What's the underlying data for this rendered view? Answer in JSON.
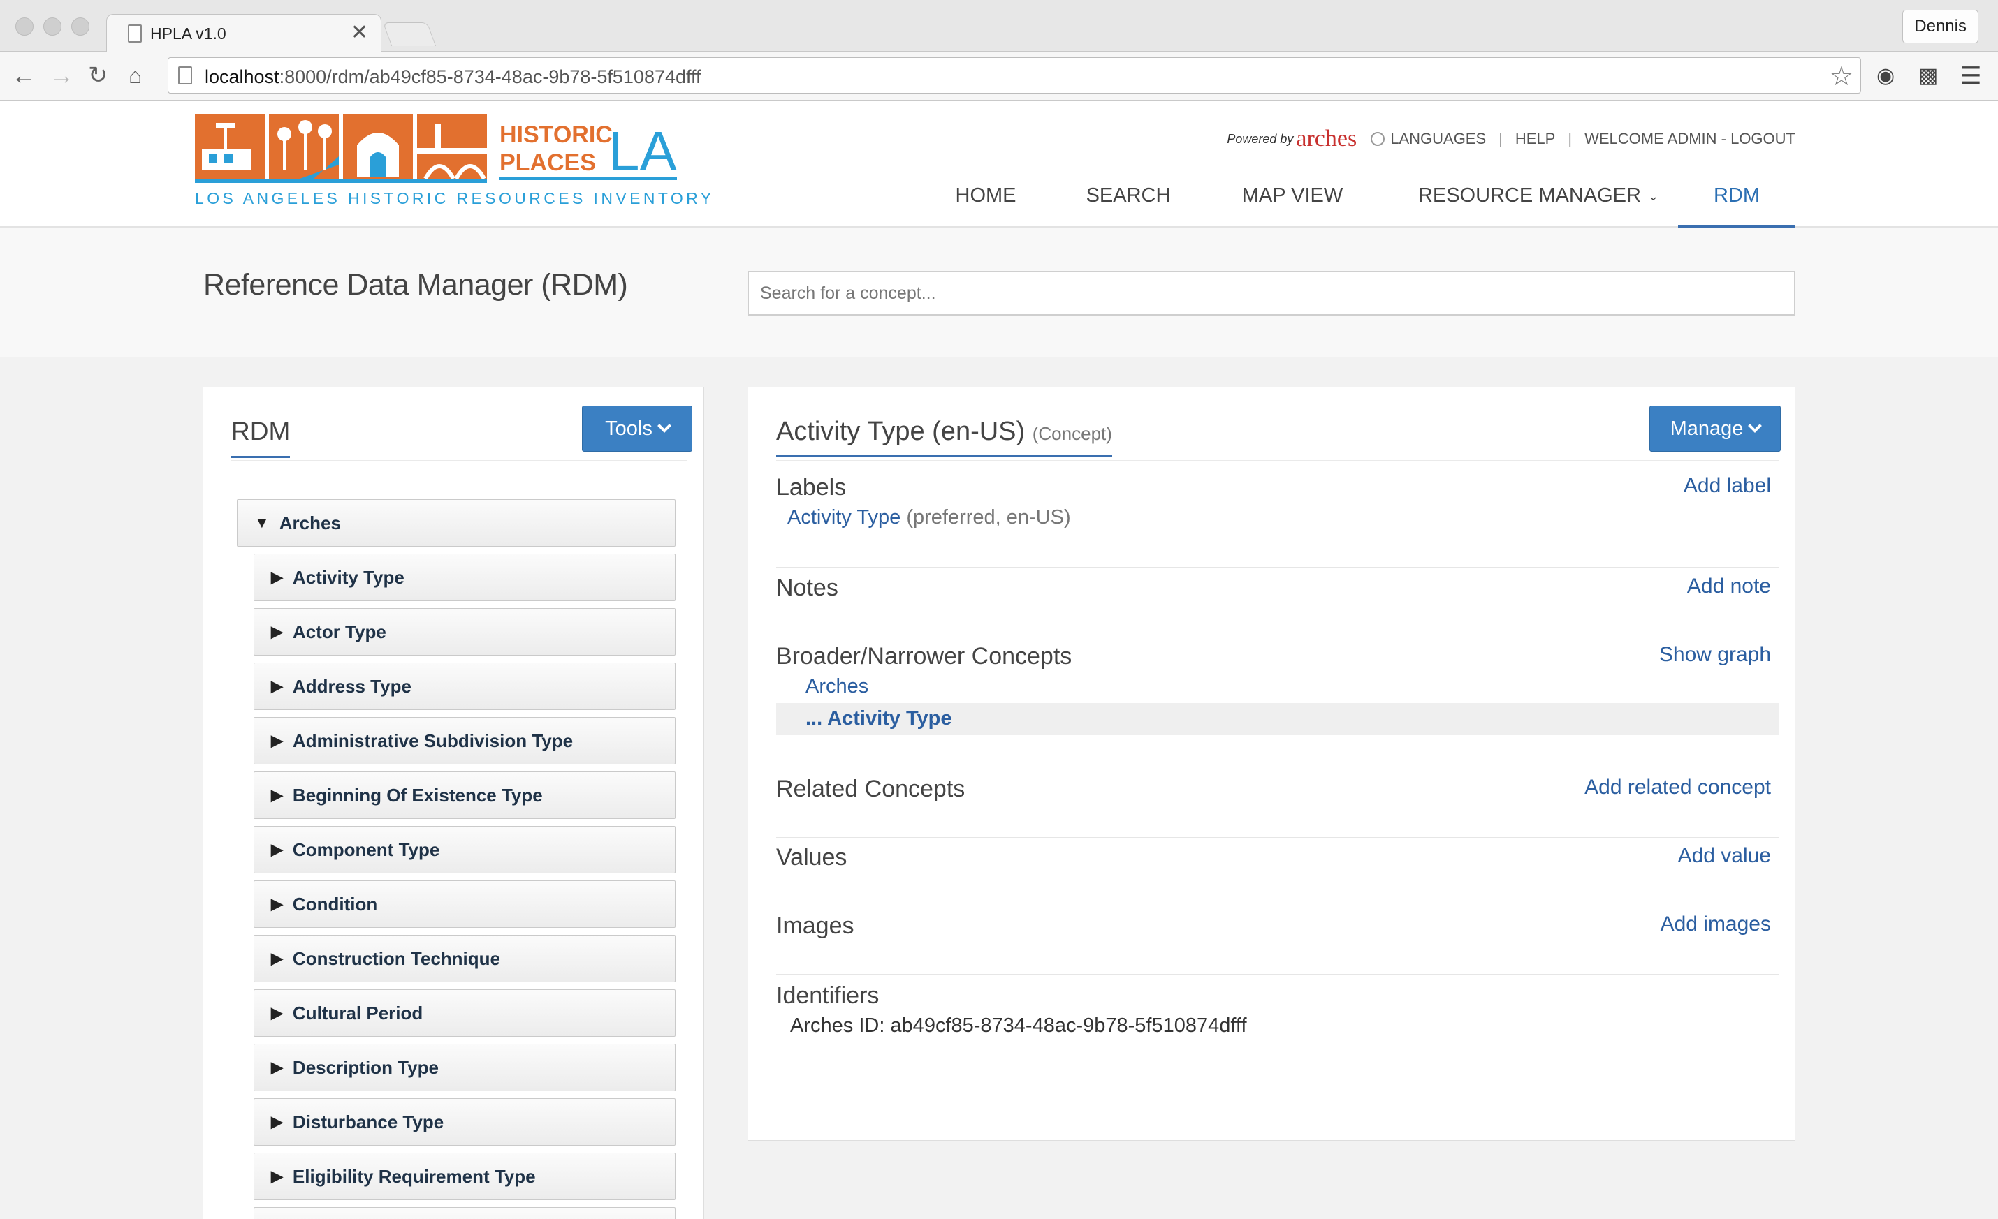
{
  "browser": {
    "tab_title": "HPLA v1.0",
    "tab_close": "✕",
    "profile_name": "Dennis",
    "url_host": "localhost",
    "url_path": ":8000/rdm/ab49cf85-8734-48ac-9b78-5f510874dfff",
    "icons": {
      "back": "back-arrow-icon",
      "forward": "forward-arrow-icon",
      "reload": "reload-icon",
      "home": "home-icon",
      "bookmark": "star-icon",
      "menu": "hamburger-menu-icon"
    }
  },
  "logo": {
    "line1": "HISTORIC",
    "line2": "PLACES",
    "big": "LA",
    "subtitle": "LOS ANGELES HISTORIC RESOURCES INVENTORY",
    "colors": {
      "orange": "#e2702f",
      "blue": "#2a9fd8"
    }
  },
  "utility": {
    "powered_by": "Powered by",
    "arches": "arches",
    "languages": "LANGUAGES",
    "help": "HELP",
    "welcome": "WELCOME ADMIN - LOGOUT"
  },
  "nav": {
    "home": "HOME",
    "search": "SEARCH",
    "map_view": "MAP VIEW",
    "resource_manager": "RESOURCE MANAGER",
    "rdm": "RDM",
    "active": "RDM"
  },
  "page": {
    "title": "Reference Data Manager (RDM)",
    "search_placeholder": "Search for a concept..."
  },
  "left_panel": {
    "tab": "RDM",
    "tools_button": "Tools",
    "root": "Arches",
    "items": [
      "Activity Type",
      "Actor Type",
      "Address Type",
      "Administrative Subdivision Type",
      "Beginning Of Existence Type",
      "Component Type",
      "Condition",
      "Construction Technique",
      "Cultural Period",
      "Description Type",
      "Disturbance Type",
      "Eligibility Requirement Type"
    ]
  },
  "concept": {
    "title": "Activity Type (en-US)",
    "type": "(Concept)",
    "manage_button": "Manage",
    "labels": {
      "heading": "Labels",
      "action": "Add label",
      "value": "Activity Type",
      "meta": "(preferred, en-US)"
    },
    "notes": {
      "heading": "Notes",
      "action": "Add note"
    },
    "hierarchy": {
      "heading": "Broader/Narrower Concepts",
      "action": "Show graph",
      "parent": "Arches",
      "current": "... Activity Type"
    },
    "related": {
      "heading": "Related Concepts",
      "action": "Add related concept"
    },
    "values": {
      "heading": "Values",
      "action": "Add value"
    },
    "images": {
      "heading": "Images",
      "action": "Add images"
    },
    "identifiers": {
      "heading": "Identifiers",
      "text": "Arches ID: ab49cf85-8734-48ac-9b78-5f510874dfff"
    }
  },
  "colors": {
    "accent_blue": "#3b80c3",
    "link_blue": "#2b5ea0",
    "arches_red": "#c8312f"
  }
}
